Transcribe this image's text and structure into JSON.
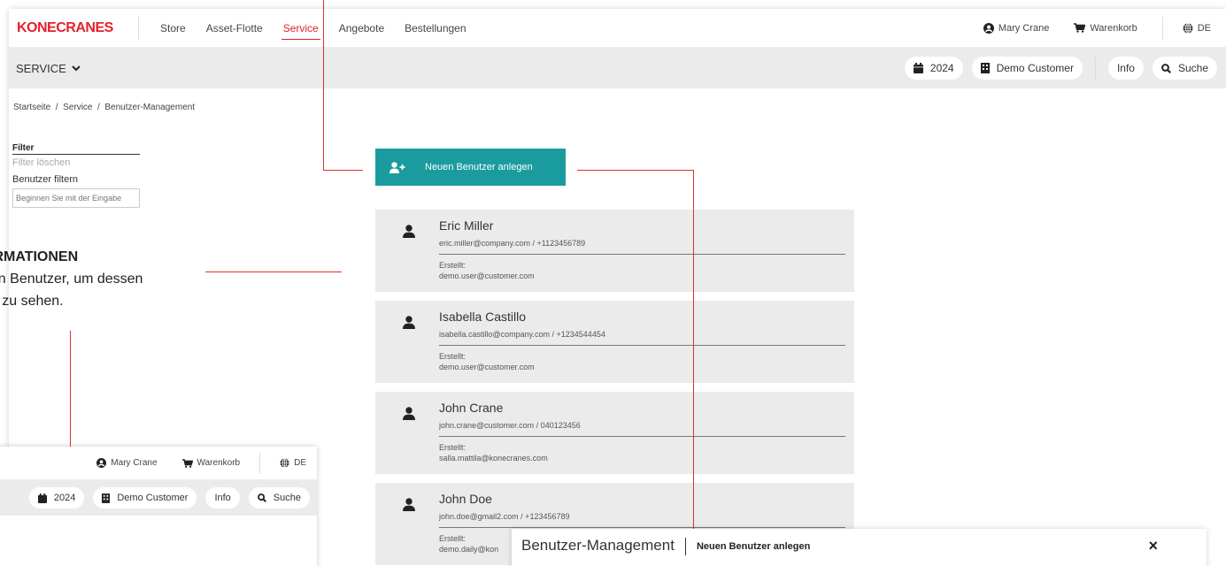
{
  "app": {
    "logo": "KONECRANES",
    "nav": [
      "Store",
      "Asset-Flotte",
      "Service",
      "Angebote",
      "Bestellungen"
    ],
    "active_nav": "Service",
    "user_name": "Mary Crane",
    "cart_label": "Warenkorb",
    "language": "DE",
    "section_label": "SERVICE",
    "year": "2024",
    "customer": "Demo Customer",
    "info_label": "Info",
    "search_label": "Suche",
    "breadcrumb": "Startseite  /  Service  /  Benutzer-Management",
    "accent_color": "#e5202e",
    "teal_color": "#1a9c9e"
  },
  "filter": {
    "title": "Filter",
    "clear": "Filter löschen",
    "label": "Benutzer filtern",
    "placeholder": "Beginnen Sie mit der Eingabe"
  },
  "new_user_button": "Neuen Benutzer anlegen",
  "users": [
    {
      "name": "Eric Miller",
      "contact": "eric.miller@company.com / +1123456789",
      "created_label": "Erstellt:",
      "created_by": "demo.user@customer.com"
    },
    {
      "name": "Isabella Castillo",
      "contact": "isabella.castillo@company.com / +1234544454",
      "created_label": "Erstellt:",
      "created_by": "demo.user@customer.com"
    },
    {
      "name": "John Crane",
      "contact": "john.crane@customer.com / 040123456",
      "created_label": "Erstellt:",
      "created_by": "salla.mattila@konecranes.com"
    },
    {
      "name": "John Doe",
      "contact": "john.doe@gmail2.com / +123456789",
      "created_label": "Erstellt:",
      "created_by": "demo.daily@kon"
    }
  ],
  "callout": {
    "title": "ORMATIONEN",
    "line1": "nen Benutzer, um dessen",
    "line2": "en zu sehen."
  },
  "mini": {
    "user_name": "Mary Crane",
    "cart_label": "Warenkorb",
    "language": "DE",
    "year": "2024",
    "customer": "Demo Customer",
    "info_label": "Info",
    "search_label": "Suche"
  },
  "modal": {
    "title": "Benutzer-Management",
    "subtitle": "Neuen Benutzer anlegen",
    "close_icon": "×"
  }
}
